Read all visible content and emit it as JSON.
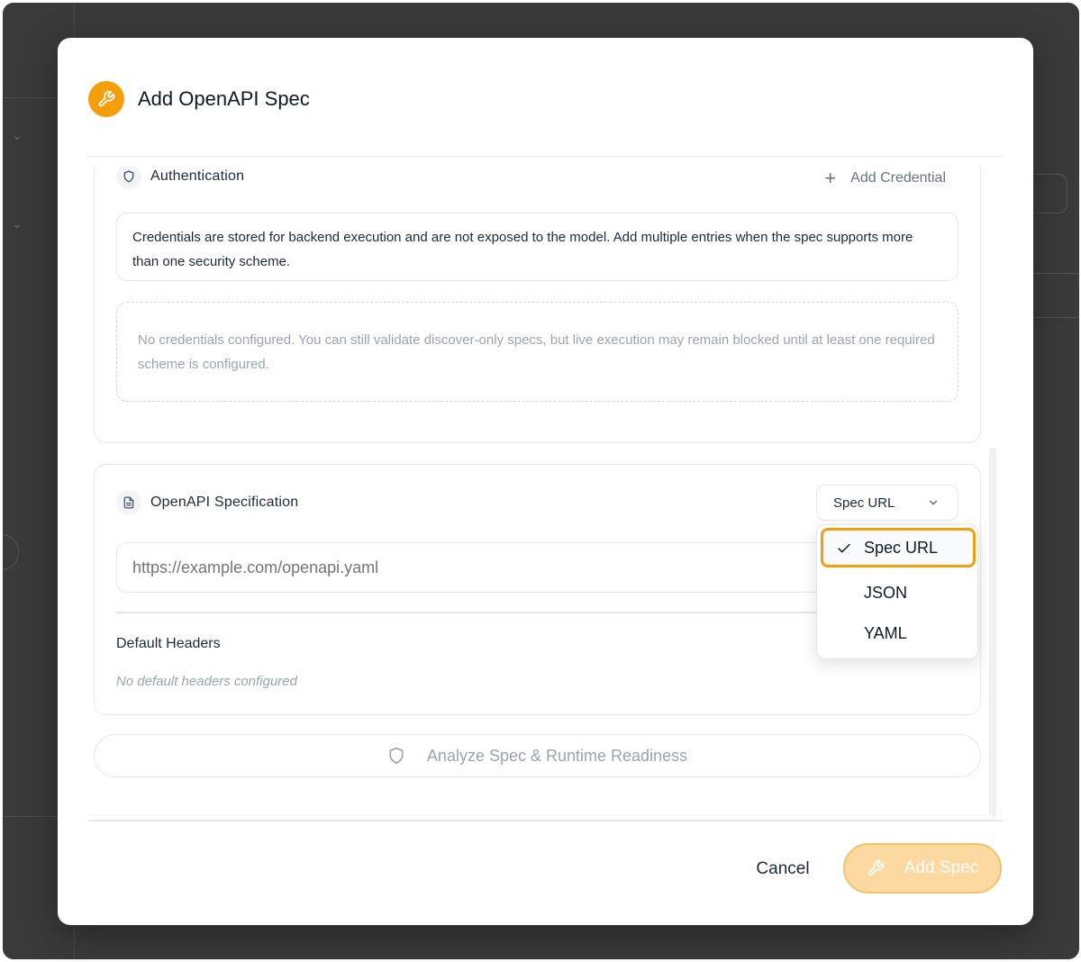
{
  "modal": {
    "title": "Add OpenAPI Spec",
    "header_icon": "wrench-icon"
  },
  "authentication": {
    "title": "Authentication",
    "icon": "shield-icon",
    "add_credential_label": "Add Credential",
    "info_text": "Credentials are stored for backend execution and are not exposed to the model. Add multiple entries when the spec supports more than one security scheme.",
    "empty_text": "No credentials configured. You can still validate discover-only specs, but live execution may remain blocked until at least one required scheme is configured."
  },
  "spec": {
    "title": "OpenAPI Specification",
    "icon": "file-icon",
    "source_select_value": "Spec URL",
    "url_placeholder": "https://example.com/openapi.yaml",
    "url_value": "",
    "default_headers_label": "Default Headers",
    "default_headers_empty": "No default headers configured",
    "source_options": [
      {
        "label": "Spec URL",
        "selected": true
      },
      {
        "label": "JSON",
        "selected": false
      },
      {
        "label": "YAML",
        "selected": false
      }
    ]
  },
  "analyze_button": "Analyze Spec & Runtime Readiness",
  "footer": {
    "cancel_label": "Cancel",
    "submit_label": "Add Spec"
  },
  "colors": {
    "accent": "#f59e0b",
    "submit_disabled_bg": "#fcd9a0",
    "backdrop": "#3a3a3a"
  }
}
